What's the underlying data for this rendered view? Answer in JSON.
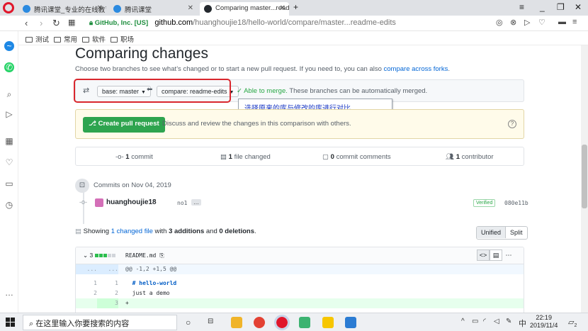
{
  "browser": {
    "tabs": [
      {
        "title": "腾讯课堂_专业的在线教育"
      },
      {
        "title": "腾讯课堂"
      },
      {
        "title": "Comparing master...read"
      }
    ],
    "new_tab": "+",
    "url": {
      "secure_label": "GitHub, Inc. [US]",
      "host": "github.com",
      "path": "/huanghoujie18/hello-world/compare/master...readme-edits"
    },
    "bookmarks": [
      "测试",
      "常用",
      "软件",
      "职场"
    ]
  },
  "page": {
    "title": "Comparing changes",
    "subtitle": "Choose two branches to see what’s changed or to start a new pull request. If you need to, you can also",
    "subtitle_link": "compare across forks",
    "subtitle_end": ".",
    "base_select": "base: master",
    "compare_select": "compare: readme-edits",
    "merge_ok": "Able to merge.",
    "merge_text": "These branches can be automatically merged.",
    "annotation": "选择原来的库与修改的库进行对比",
    "create_pr_label": "Create pull request",
    "pr_description": "Discuss and review the changes in this comparison with others.",
    "stats": {
      "commits_count": "1",
      "commits_label": "commit",
      "files_count": "1",
      "files_label": "file changed",
      "comments_count": "0",
      "comments_label": "commit comments",
      "contributors_count": "1",
      "contributors_label": "contributor"
    },
    "commits_date": "Commits on Nov 04, 2019",
    "commit": {
      "author": "huanghoujie18",
      "message": "no1",
      "dots": "…",
      "verified": "Verified",
      "sha": "080e11b"
    },
    "showing": {
      "prefix": "Showing",
      "files": "1 changed file",
      "with": "with",
      "additions": "3 additions",
      "and": "and",
      "deletions": "0 deletions",
      "end": "."
    },
    "view_unified": "Unified",
    "view_split": "Split",
    "file": {
      "change_count": "3",
      "name": "README.md",
      "hunk_header": "@@ -1,2 +1,5 @@",
      "lines": [
        {
          "old": "1",
          "new": "1",
          "text": "  # hello-world",
          "type": "context"
        },
        {
          "old": "2",
          "new": "2",
          "text": "  just a demo",
          "type": "context"
        },
        {
          "old": "",
          "new": "3",
          "text": "+",
          "type": "add"
        }
      ]
    }
  },
  "taskbar": {
    "search_placeholder": "在这里输入你要搜索的内容",
    "time": "22:19",
    "date": "2019/11/4",
    "ime": "中",
    "notifications": "2"
  },
  "colors": {
    "accent_green": "#2ea44f",
    "annotation_red": "#d9272e",
    "link_blue": "#0366d6"
  }
}
